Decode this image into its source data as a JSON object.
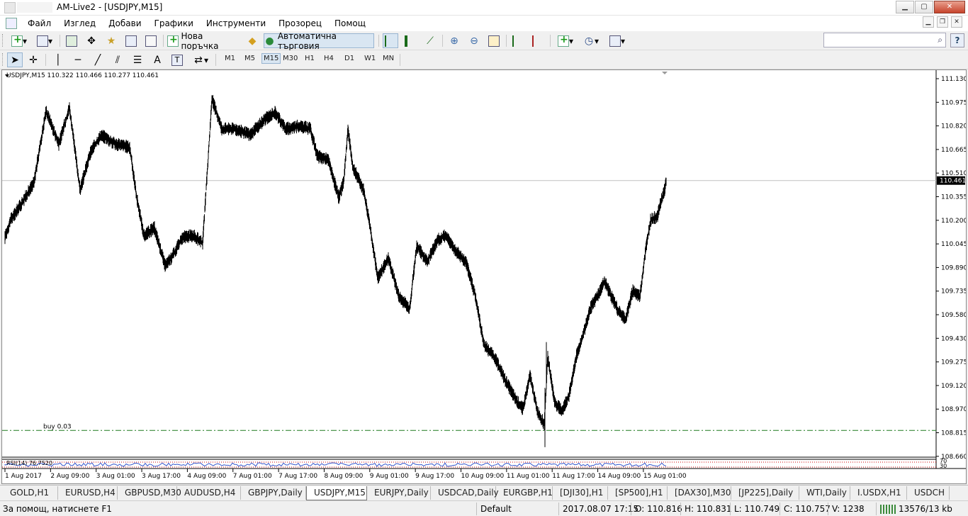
{
  "window": {
    "title": "AM-Live2 - [USDJPY,M15]",
    "btn_min": "▁",
    "btn_max": "▢",
    "btn_close": "✕"
  },
  "menu": [
    "Файл",
    "Изглед",
    "Добави",
    "Графики",
    "Инструменти",
    "Прозорец",
    "Помощ"
  ],
  "mdi": {
    "min": "▁",
    "restore": "❐",
    "close": "✕"
  },
  "toolbar": {
    "new_order": "Нова поръчка",
    "auto_trading": "Автоматична търговия",
    "text_tool": "A",
    "label_tool": "T"
  },
  "timeframes": [
    "M1",
    "M5",
    "M15",
    "M30",
    "H1",
    "H4",
    "D1",
    "W1",
    "MN"
  ],
  "active_timeframe": "M15",
  "chart": {
    "symbol_line": "USDJPY,M15  110.322 110.466 110.277 110.461",
    "current_price_label": "110.461",
    "order_label": "buy 0.03",
    "rsi_label": "RSI(14) 76.7520",
    "rsi_levels": [
      "70",
      "30"
    ],
    "price_ticks": [
      "111.130",
      "110.975",
      "110.820",
      "110.665",
      "110.510",
      "110.355",
      "110.200",
      "110.045",
      "109.890",
      "109.735",
      "109.580",
      "109.430",
      "109.275",
      "109.120",
      "108.970",
      "108.815",
      "108.660"
    ],
    "time_ticks": [
      "1 Aug 2017",
      "2 Aug 09:00",
      "3 Aug 01:00",
      "3 Aug 17:00",
      "4 Aug 09:00",
      "7 Aug 01:00",
      "7 Aug 17:00",
      "8 Aug 09:00",
      "9 Aug 01:00",
      "9 Aug 17:00",
      "10 Aug 09:00",
      "11 Aug 01:00",
      "11 Aug 17:00",
      "14 Aug 09:00",
      "15 Aug 01:00"
    ],
    "colors": {
      "price": "#000000",
      "order_line": "#1f7a1f",
      "price_line": "#c0c0c0",
      "rsi_line": "#3355cc",
      "rsi_level": "#cc0000"
    }
  },
  "tabs": [
    "GOLD,H1",
    "EURUSD,H4",
    "GBPUSD,M30",
    "AUDUSD,H4",
    "GBPJPY,Daily",
    "USDJPY,M15",
    "EURJPY,Daily",
    "USDCAD,Daily",
    "EURGBP,H1",
    "[DJI30],H1",
    "[SP500],H1",
    "[DAX30],M30",
    "[JP225],Daily",
    "WTI,Daily",
    "I.USDX,H1",
    "USDCH"
  ],
  "active_tab": "USDJPY,M15",
  "status": {
    "help": "За помощ, натиснете F1",
    "profile": "Default",
    "datetime": "2017.08.07 17:15",
    "open": "O: 110.816",
    "high": "H: 110.831",
    "low": "L: 110.749",
    "close": "C: 110.757",
    "volume": "V: 1238",
    "traffic": "13576/13 kb"
  }
}
